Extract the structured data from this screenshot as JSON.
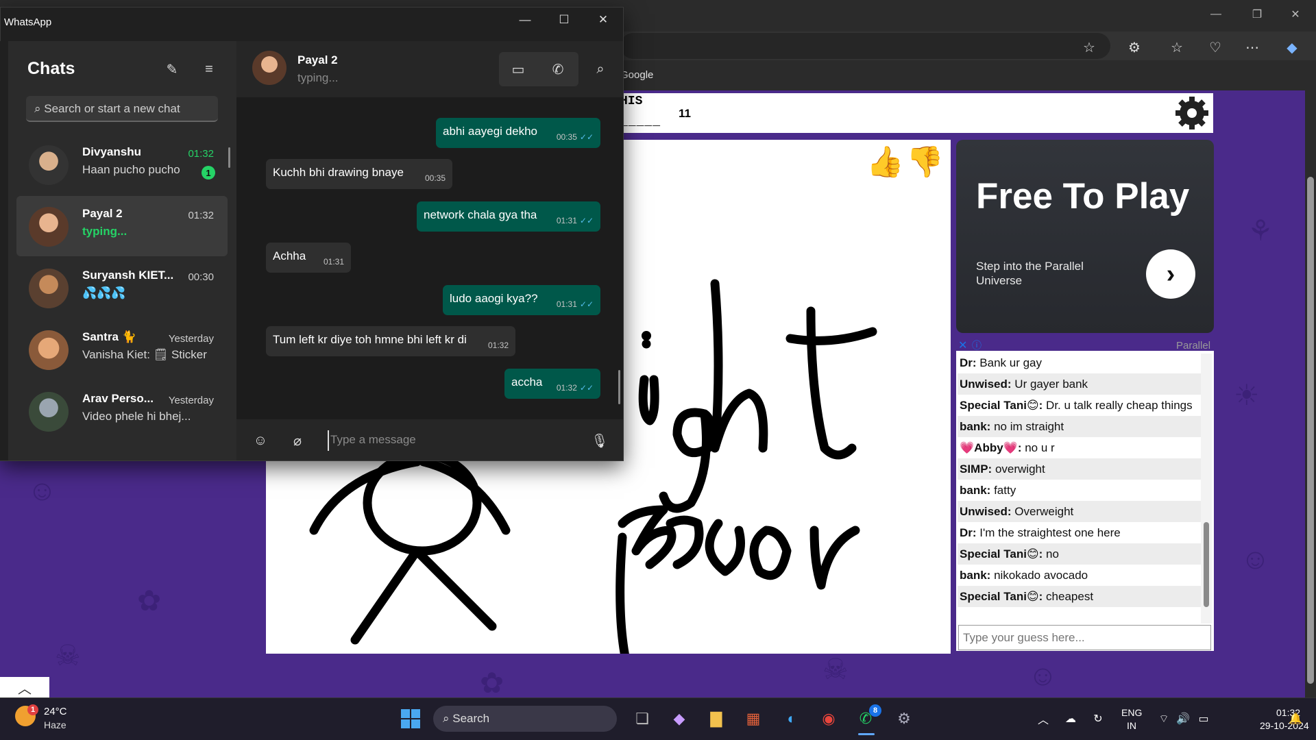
{
  "browser": {
    "favorites": {
      "google": "Google"
    }
  },
  "game": {
    "hint_word": "HIS",
    "blanks": "_____",
    "letter_count": "11",
    "ad": {
      "title": "Free To Play",
      "subtitle": "Step into the Parallel Universe",
      "brand": "Parallel"
    },
    "chat": [
      {
        "name": "Dr:",
        "text": " Bank ur gay"
      },
      {
        "name": "Unwised:",
        "text": " Ur gayer bank"
      },
      {
        "name": "Special Tani😊:",
        "text": " Dr. u talk really cheap things"
      },
      {
        "name": "bank:",
        "text": " no im straight"
      },
      {
        "name": "💗Abby💗:",
        "text": " no u r"
      },
      {
        "name": "SIMP:",
        "text": " overwight"
      },
      {
        "name": "bank:",
        "text": " fatty"
      },
      {
        "name": "Unwised:",
        "text": " Overweight"
      },
      {
        "name": "Dr:",
        "text": " I'm the straightest one here"
      },
      {
        "name": "Special Tani😊:",
        "text": " no"
      },
      {
        "name": "bank:",
        "text": " nikokado avocado"
      },
      {
        "name": "Special Tani😊:",
        "text": " cheapest"
      }
    ],
    "guess_placeholder": "Type your guess here..."
  },
  "whatsapp": {
    "window_title": "WhatsApp",
    "sidebar": {
      "title": "Chats",
      "search_placeholder": "Search or start a new chat",
      "chats": [
        {
          "name": "Divyanshu",
          "time": "01:32",
          "preview": "Haan pucho pucho",
          "unread": "1"
        },
        {
          "name": "Payal 2",
          "time": "01:32",
          "preview": "typing..."
        },
        {
          "name": "Suryansh KIET...",
          "time": "00:30",
          "preview": "💦💦💦"
        },
        {
          "name": "Santra 🐈",
          "time": "Yesterday",
          "preview": "Vanisha Kiet: 🗒 Sticker"
        },
        {
          "name": "Arav Perso...",
          "time": "Yesterday",
          "preview": "Video phele hi bhej..."
        }
      ]
    },
    "conversation": {
      "name": "Payal 2",
      "status": "typing...",
      "messages": [
        {
          "dir": "out",
          "text": "abhi aayegi dekho",
          "time": "00:35"
        },
        {
          "dir": "in",
          "text": "Kuchh bhi drawing bnaye",
          "time": "00:35"
        },
        {
          "dir": "out",
          "text": "network chala gya tha",
          "time": "01:31"
        },
        {
          "dir": "in",
          "text": "Achha",
          "time": "01:31"
        },
        {
          "dir": "out",
          "text": "ludo aaogi kya??",
          "time": "01:31"
        },
        {
          "dir": "in",
          "text": "Tum left kr diye toh hmne bhi left kr di",
          "time": "01:32"
        },
        {
          "dir": "out",
          "text": "accha",
          "time": "01:32"
        }
      ],
      "input_placeholder": "Type a message"
    }
  },
  "taskbar": {
    "weather": {
      "temp": "24°C",
      "condition": "Haze",
      "badge": "1"
    },
    "search": "Search",
    "whatsapp_badge": "8",
    "lang_line1": "ENG",
    "lang_line2": "IN",
    "time": "01:32",
    "date": "29-10-2024"
  },
  "colors": {
    "whatsapp_green": "#25d366",
    "outgoing_bubble": "#00584a",
    "game_background": "#4a2a8a"
  }
}
